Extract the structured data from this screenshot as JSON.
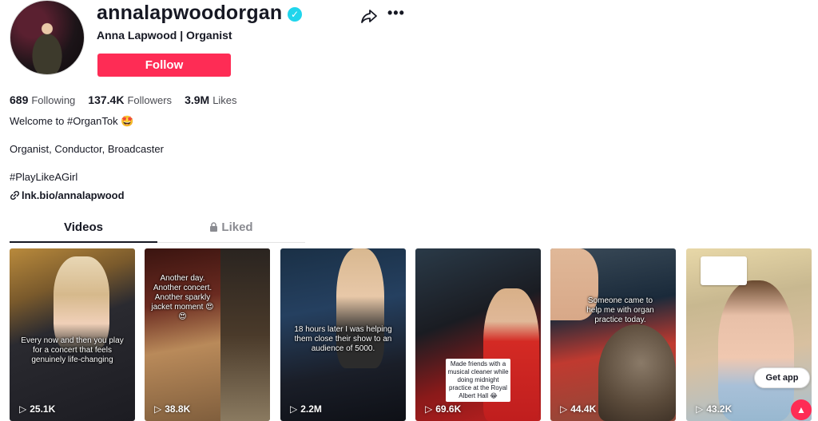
{
  "profile": {
    "username": "annalapwoodorgan",
    "subtitle": "Anna Lapwood | Organist",
    "follow_label": "Follow",
    "verified_icon": "verified-check-icon",
    "share_icon": "share-arrow-icon",
    "more_icon": "more-dots-icon"
  },
  "stats": {
    "following_count": "689",
    "following_label": "Following",
    "followers_count": "137.4K",
    "followers_label": "Followers",
    "likes_count": "3.9M",
    "likes_label": "Likes"
  },
  "bio": {
    "line1": "Welcome to #OrganTok 🤩",
    "line2": "Organist, Conductor, Broadcaster",
    "line3": "#PlayLikeAGirl",
    "link": "lnk.bio/annalapwood"
  },
  "tabs": {
    "videos": "Videos",
    "liked": "Liked"
  },
  "videos": [
    {
      "overlay": "Every now and then you play for a concert that feels genuinely life-changing",
      "views": "25.1K"
    },
    {
      "overlay": "Another day. Another concert. Another sparkly jacket moment 😍😍",
      "views": "38.8K"
    },
    {
      "overlay": "18 hours later I was helping them close their show to an audience of 5000.",
      "views": "2.2M"
    },
    {
      "overlay": "Made friends with a musical cleaner while doing midnight practice at the Royal Albert Hall 😂",
      "views": "69.6K"
    },
    {
      "overlay": "Someone came to help me with organ practice today.",
      "views": "44.4K"
    },
    {
      "overlay": "",
      "views": "43.2K"
    }
  ],
  "get_app_label": "Get app",
  "colors": {
    "brand": "#fe2c55",
    "verified": "#20d5ec"
  }
}
